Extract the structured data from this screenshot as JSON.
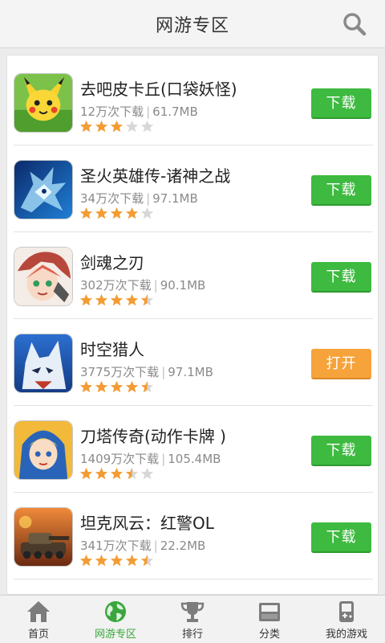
{
  "header": {
    "title": "网游专区",
    "search_icon": "search-icon"
  },
  "colors": {
    "download": "#3dba3f",
    "open": "#f6a33b",
    "star_on": "#f39c34",
    "star_off": "#d7d7d7",
    "active_tab": "#36a83a"
  },
  "apps": [
    {
      "name": "去吧皮卡丘(口袋妖怪)",
      "downloads": "12万次下载",
      "size": "61.7MB",
      "rating": 3,
      "action": "下载",
      "action_type": "download"
    },
    {
      "name": "圣火英雄传-诸神之战",
      "downloads": "34万次下载",
      "size": "97.1MB",
      "rating": 4,
      "action": "下载",
      "action_type": "download"
    },
    {
      "name": "剑魂之刃",
      "downloads": "302万次下载",
      "size": "90.1MB",
      "rating": 4.5,
      "action": "下载",
      "action_type": "download"
    },
    {
      "name": "时空猎人",
      "downloads": "3775万次下载",
      "size": "97.1MB",
      "rating": 4.5,
      "action": "打开",
      "action_type": "open"
    },
    {
      "name": "刀塔传奇(动作卡牌 )",
      "downloads": "1409万次下载",
      "size": "105.4MB",
      "rating": 3.5,
      "action": "下载",
      "action_type": "download"
    },
    {
      "name": "坦克风云：红警OL",
      "downloads": "341万次下载",
      "size": "22.2MB",
      "rating": 4.5,
      "action": "下载",
      "action_type": "download"
    }
  ],
  "tabs": [
    {
      "label": "首页",
      "icon": "home-icon",
      "active": false
    },
    {
      "label": "网游专区",
      "icon": "globe-icon",
      "active": true
    },
    {
      "label": "排行",
      "icon": "trophy-icon",
      "active": false
    },
    {
      "label": "分类",
      "icon": "tray-icon",
      "active": false
    },
    {
      "label": "我的游戏",
      "icon": "gamepad-icon",
      "active": false
    }
  ]
}
